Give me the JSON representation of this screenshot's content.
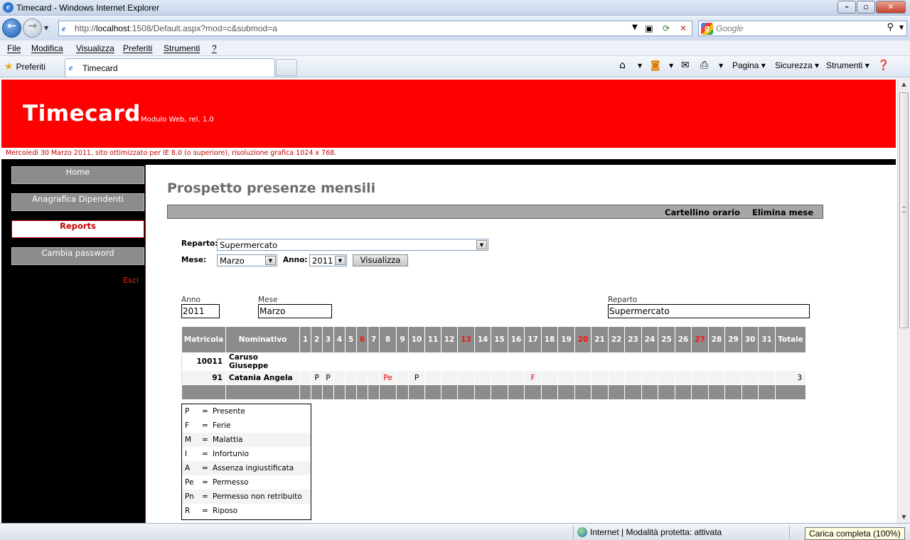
{
  "window": {
    "title": "Timecard - Windows Internet Explorer"
  },
  "address": {
    "url_prefix": "http://",
    "url_host": "localhost",
    "url_rest": ":1508/Default.aspx?mod=c&submod=a",
    "search_placeholder": "Google"
  },
  "menu": [
    "File",
    "Modifica",
    "Visualizza",
    "Preferiti",
    "Strumenti",
    "?"
  ],
  "favbar": {
    "favorites": "Preferiti",
    "tab_title": "Timecard",
    "commands": {
      "page": "Pagina",
      "security": "Sicurezza",
      "tools": "Strumenti"
    }
  },
  "site": {
    "brand": "Timecard",
    "brand_sub": "Modulo Web, rel. 1.0",
    "dateline": "Mercoledì 30 Marzo 2011, sito ottimizzato per IE 8.0 (o superiore), risoluzione grafica 1024 x 768."
  },
  "sidebar": {
    "items": [
      {
        "label": "Home",
        "active": false
      },
      {
        "label": "Anagrafica Dipendenti",
        "active": false
      },
      {
        "label": "Reports",
        "active": true
      },
      {
        "label": "Cambia password",
        "active": false
      }
    ],
    "logout": "Esci"
  },
  "main": {
    "title": "Prospetto presenze mensili",
    "toolbar": {
      "timecard": "Cartellino orario",
      "delete_month": "Elimina mese"
    },
    "filters": {
      "department_label": "Reparto:",
      "department_value": "Supermercato",
      "month_label": "Mese:",
      "month_value": "Marzo",
      "year_label": "Anno:",
      "year_value": "2011",
      "submit": "Visualizza"
    },
    "summary": {
      "year_caption": "Anno",
      "year_value": "2011",
      "month_caption": "Mese",
      "month_value": "Marzo",
      "dept_caption": "Reparto",
      "dept_value": "Supermercato"
    },
    "grid": {
      "col_matricola": "Matricola",
      "col_nominativo": "Nominativo",
      "col_totale": "Totale",
      "days": [
        "1",
        "2",
        "3",
        "4",
        "5",
        "6",
        "7",
        "8",
        "9",
        "10",
        "11",
        "12",
        "13",
        "14",
        "15",
        "16",
        "17",
        "18",
        "19",
        "20",
        "21",
        "22",
        "23",
        "24",
        "25",
        "26",
        "27",
        "28",
        "29",
        "30",
        "31"
      ],
      "holidays": [
        "6",
        "13",
        "20",
        "27"
      ],
      "rows": [
        {
          "matricola": "10011",
          "nominativo": "Caruso Giuseppe",
          "days": [
            "",
            "",
            "",
            "",
            "",
            "",
            "",
            "",
            "",
            "",
            "",
            "",
            "",
            "",
            "",
            "",
            "",
            "",
            "",
            "",
            "",
            "",
            "",
            "",
            "",
            "",
            "",
            "",
            "",
            "",
            ""
          ],
          "totale": ""
        },
        {
          "matricola": "91",
          "nominativo": "Catania Angela",
          "days": [
            "",
            "P",
            "P",
            "",
            "",
            "",
            "",
            "Pe",
            "",
            "P",
            "",
            "",
            "",
            "",
            "",
            "",
            "F",
            "",
            "",
            "",
            "",
            "",
            "",
            "",
            "",
            "",
            "",
            "",
            "",
            "",
            ""
          ],
          "totale": "3"
        }
      ]
    },
    "legend": [
      {
        "code": "P",
        "desc": "Presente"
      },
      {
        "code": "F",
        "desc": "Ferie"
      },
      {
        "code": "M",
        "desc": "Malattia"
      },
      {
        "code": "I",
        "desc": "Infortunio"
      },
      {
        "code": "A",
        "desc": "Assenza ingiustificata"
      },
      {
        "code": "Pe",
        "desc": "Permesso"
      },
      {
        "code": "Pn",
        "desc": "Permesso non retribuito"
      },
      {
        "code": "R",
        "desc": "Riposo"
      }
    ],
    "legend_eq": "="
  },
  "status": {
    "zone": "Internet | Modalità protetta: attivata",
    "tooltip": "Carica completa (100%)"
  },
  "colors": {
    "brand_red": "#ff0000",
    "nav_gray": "#8c8c8c",
    "accent_red": "#c00000"
  }
}
